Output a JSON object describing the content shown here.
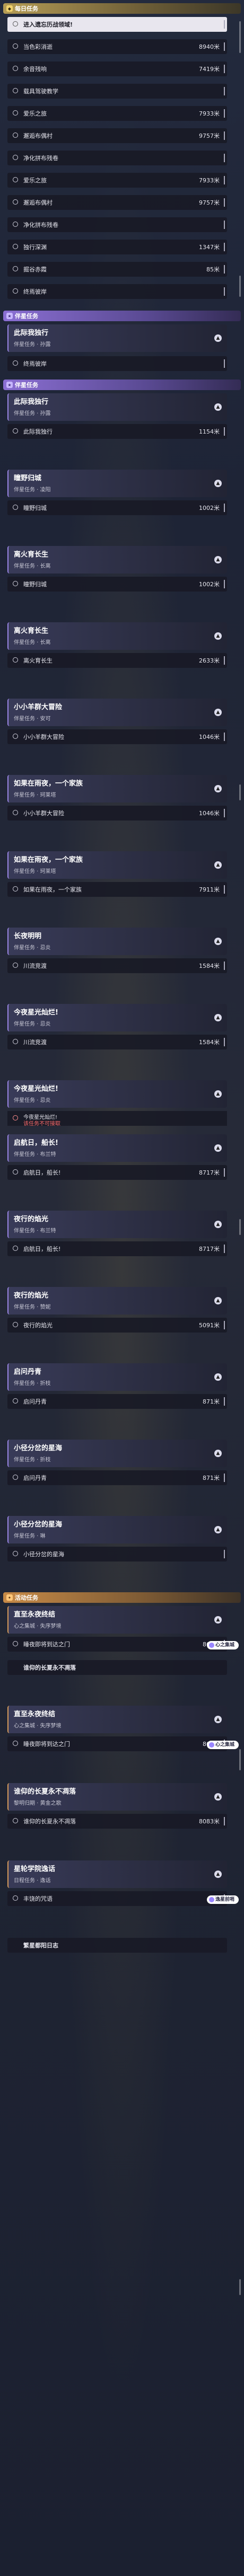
{
  "sections": {
    "daily": "每日任务",
    "companion": "伴星任务",
    "event": "活动任务"
  },
  "daily_items": [
    {
      "label": "进入遗忘历战领域!",
      "value": ""
    },
    {
      "label": "当色彩消逝",
      "value": "8940米"
    },
    {
      "label": "余音残响",
      "value": "7419米"
    },
    {
      "label": "载具驾驶教学",
      "value": ""
    },
    {
      "label": "爱乐之旅",
      "value": "7933米"
    },
    {
      "label": "邂逅布偶村",
      "value": "9757米"
    },
    {
      "label": "净化拼布残卷",
      "value": ""
    },
    {
      "label": "爱乐之旅",
      "value": "7933米"
    },
    {
      "label": "邂逅布偶村",
      "value": "9757米"
    },
    {
      "label": "净化拼布残卷",
      "value": ""
    },
    {
      "label": "独行深渊",
      "value": "1347米"
    },
    {
      "label": "掘谷赤霞",
      "value": "85米"
    },
    {
      "label": "终焉彼岸",
      "value": ""
    }
  ],
  "companion_top": {
    "title": "此际我独行",
    "subtitle": "伴星任务 · 孙露",
    "extra": "终焉彼岸"
  },
  "companion_groups": [
    {
      "title": "此际我独行",
      "sub": "伴星任务 · 孙露",
      "row": "此际我独行",
      "value": "1154米"
    },
    {
      "title": "瞳野归城",
      "sub": "伴星任务 · 凌阳",
      "row": "瞳野归城",
      "value": "1002米"
    },
    {
      "title": "离火育长生",
      "sub": "伴星任务 · 长离",
      "row": "瞳野归城",
      "value": "1002米"
    },
    {
      "title": "离火育长生",
      "sub": "伴星任务 · 长离",
      "row": "离火育长生",
      "value": "2633米"
    },
    {
      "title": "小小羊群大冒险",
      "sub": "伴星任务 · 安可",
      "row": "小小羊群大冒险",
      "value": "1046米"
    },
    {
      "title": "如果在雨夜，一个家族",
      "sub": "伴星任务 · 珂莱塔",
      "row": "小小羊群大冒险",
      "value": "1046米"
    },
    {
      "title": "如果在雨夜，一个家族",
      "sub": "伴星任务 · 珂莱塔",
      "row": "如果在雨夜，一个家族",
      "value": "7911米"
    },
    {
      "title": "长夜明明",
      "sub": "伴星任务 · 忌炎",
      "row": "川流竞渡",
      "value": "1584米"
    },
    {
      "title": "今夜星光灿烂!",
      "sub": "伴星任务 · 忌炎",
      "row": "川流竞渡",
      "value": "1584米"
    },
    {
      "title": "今夜星光灿烂!",
      "sub": "伴星任务 · 忌炎",
      "row": "",
      "value": ""
    },
    {
      "title": "启航日，船长!",
      "sub": "伴星任务 · 布兰特",
      "row": "启航日，船长!",
      "value": "8717米"
    },
    {
      "title": "夜行的焰光",
      "sub": "伴星任务 · 布兰特",
      "row": "启航日，船长!",
      "value": "8717米"
    },
    {
      "title": "夜行的焰光",
      "sub": "伴星任务 · 赞妮",
      "row": "夜行的焰光",
      "value": "5091米"
    },
    {
      "title": "启问丹青",
      "sub": "伴星任务 · 折枝",
      "row": "启问丹青",
      "value": "871米"
    },
    {
      "title": "小径分岔的星海",
      "sub": "伴星任务 · 折枝",
      "row": "启问丹青",
      "value": "871米"
    },
    {
      "title": "小径分岔的星海",
      "sub": "伴星任务 · 琳",
      "row": "小径分岔的星海",
      "value": ""
    }
  ],
  "warn": {
    "line1": "今夜星光灿烂!",
    "line2": "该任务不可接取"
  },
  "event_groups": [
    {
      "title": "直至永夜终结",
      "sub": "心之集城 · 失序梦境",
      "row": "睡夜即将到达之门",
      "value": "868米",
      "pill": "心之集城"
    },
    {
      "title": "直至永夜终结",
      "sub": "心之集城 · 失序梦境",
      "row": "睡夜即将到达之门",
      "value": "868米",
      "pill": "心之集城"
    },
    {
      "title": "谁仰的长夏永不凋落",
      "sub": "黎明归期 · 黄金之歌",
      "row": "谁仰的长夏永不凋落",
      "value": "8083米",
      "pill": ""
    },
    {
      "title": "星轮学院逸话",
      "sub": "日程任务 · 逸话",
      "row": "丰饶的咒语",
      "value": "",
      "pill": "逸星前哨"
    }
  ],
  "extras": {
    "event_mid": "谁仰的长夏永不凋落",
    "bottom_title": "繁星都阳日志"
  }
}
